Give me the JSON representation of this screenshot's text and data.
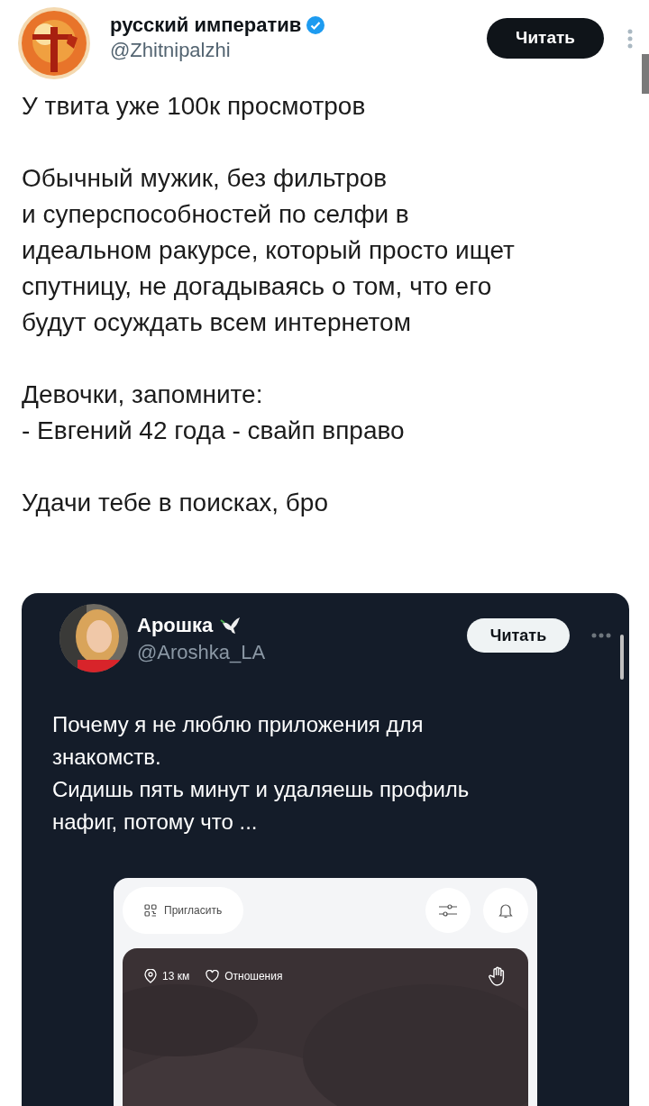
{
  "author": {
    "name": "русский императив",
    "handle": "@Zhitnipalzhi",
    "verified": true,
    "follow_button": "Читать"
  },
  "text": [
    "У твита уже 100к просмотров",
    "Обычный мужик, без фильтров\nи  суперспособностей по селфи в\nидеальном ракурсе, который просто ищет\nспутницу, не догадываясь о том, что его\nбудут осуждать всем интернетом",
    "Девочки, запомните:\n- Евгений 42 года - свайп вправо",
    "Удачи тебе в поисках, бро"
  ],
  "quoted": {
    "author": {
      "name": "Арошка",
      "handle": "@Aroshka_LA",
      "follow_button": "Читать"
    },
    "text": "Почему я не люблю приложения для\nзнакомств.\nСидишь пять минут и удаляешь профиль\nнафиг, потому что ...",
    "app": {
      "invite_button": "Пригласить",
      "distance": "13 км",
      "goal": "Отношения"
    }
  }
}
